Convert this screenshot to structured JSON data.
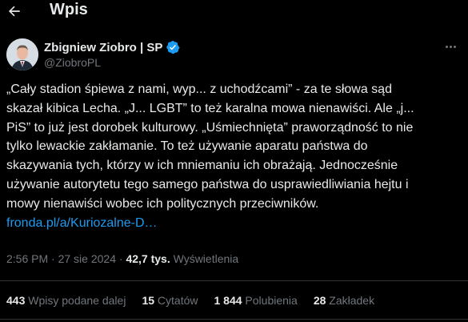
{
  "header": {
    "back_icon": "arrow-left-icon",
    "title": "Wpis"
  },
  "author": {
    "name": "Zbigniew Ziobro | SP",
    "handle": "@ZiobroPL",
    "verified_icon": "verified-badge-icon",
    "verified_color": "#1d9bf0"
  },
  "tweet": {
    "lines": [
      "„Cały stadion śpiewa z nami, wyp... z uchodźcami” - za te słowa sąd",
      "skazał kibica Lecha. „J... LGBT” to też karalna mowa nienawiści. Ale „j...",
      "PiS” to już jest dorobek kulturowy. „Uśmiechnięta” praworządność to nie",
      "tylko lewackie zakłamanie. To też używanie aparatu państwa do",
      "skazywania tych, którzy w ich mniemaniu ich obrażają. Jednocześnie",
      "używanie autorytetu tego samego państwa do usprawiedliwiania hejtu i",
      "mowy nienawiści wobec ich politycznych przeciwników."
    ],
    "link": "fronda.pl/a/Kuriozalne-D…"
  },
  "meta": {
    "time": "2:56 PM",
    "separator": "·",
    "date": "27 sie 2024",
    "views_count": "42,7 tys.",
    "views_label": "Wyświetlenia"
  },
  "stats": {
    "reposts_count": "443",
    "reposts_label": "Wpisy podane dalej",
    "quotes_count": "15",
    "quotes_label": "Cytatów",
    "likes_count": "1 844",
    "likes_label": "Polubienia",
    "bookmarks_count": "28",
    "bookmarks_label": "Zakładek"
  },
  "colors": {
    "background": "#000000",
    "text": "#e7e9ea",
    "secondary": "#71767b",
    "accent": "#1d9bf0",
    "divider": "#2f3336"
  }
}
